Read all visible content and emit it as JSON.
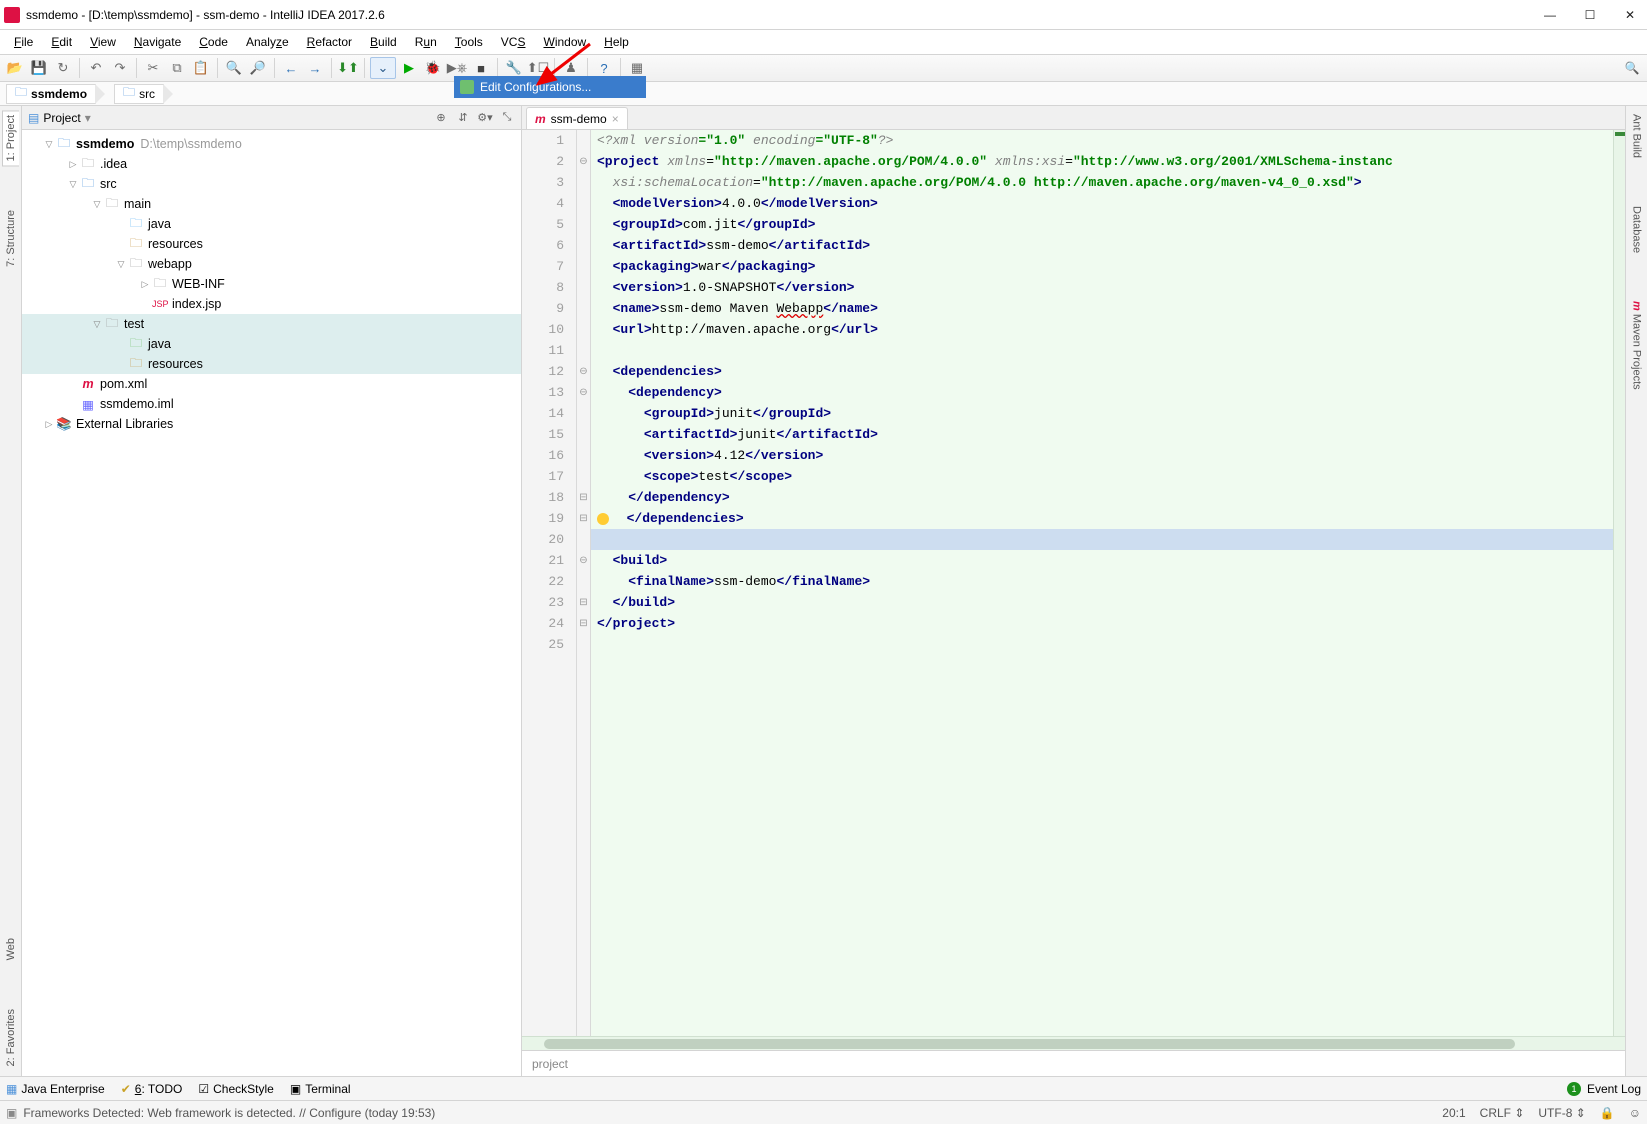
{
  "window": {
    "title": "ssmdemo - [D:\\temp\\ssmdemo] - ssm-demo - IntelliJ IDEA 2017.2.6"
  },
  "menu": {
    "items": [
      "File",
      "Edit",
      "View",
      "Navigate",
      "Code",
      "Analyze",
      "Refactor",
      "Build",
      "Run",
      "Tools",
      "VCS",
      "Window",
      "Help"
    ]
  },
  "runDropdown": {
    "label": "Edit Configurations..."
  },
  "breadcrumbs": {
    "a": "ssmdemo",
    "b": "src"
  },
  "leftTabs": {
    "project": "1: Project",
    "structure": "7: Structure",
    "web": "Web",
    "favorites": "2: Favorites"
  },
  "rightTabs": {
    "ant": "Ant Build",
    "database": "Database",
    "maven": "Maven Projects"
  },
  "projectPane": {
    "title": "Project",
    "root": {
      "name": "ssmdemo",
      "path": "D:\\temp\\ssmdemo"
    },
    "idea": ".idea",
    "src": "src",
    "main": "main",
    "java": "java",
    "resources": "resources",
    "webapp": "webapp",
    "webinf": "WEB-INF",
    "indexjsp": "index.jsp",
    "test": "test",
    "pom": "pom.xml",
    "iml": "ssmdemo.iml",
    "extlib": "External Libraries"
  },
  "editor": {
    "tabName": "ssm-demo",
    "crumb": "project",
    "lines": [
      {
        "n": 1
      },
      {
        "n": 2
      },
      {
        "n": 3
      },
      {
        "n": 4
      },
      {
        "n": 5
      },
      {
        "n": 6
      },
      {
        "n": 7
      },
      {
        "n": 8
      },
      {
        "n": 9
      },
      {
        "n": 10
      },
      {
        "n": 11
      },
      {
        "n": 12
      },
      {
        "n": 13
      },
      {
        "n": 14
      },
      {
        "n": 15
      },
      {
        "n": 16
      },
      {
        "n": 17
      },
      {
        "n": 18
      },
      {
        "n": 19
      },
      {
        "n": 20
      },
      {
        "n": 21
      },
      {
        "n": 22
      },
      {
        "n": 23
      },
      {
        "n": 24
      },
      {
        "n": 25
      }
    ],
    "xml": {
      "decl_a": "<?xml version",
      "decl_b": "=\"1.0\"",
      "decl_c": " encoding",
      "decl_d": "=\"UTF-8\"",
      "decl_e": "?>",
      "proj_open": "<project ",
      "xmlns": "xmlns",
      "eq": "=",
      "url1": "\"http://maven.apache.org/POM/4.0.0\"",
      "sp": " ",
      "xmlnsxsi": "xmlns:xsi",
      "url2": "\"http://www.w3.org/2001/XMLSchema-instanc",
      "schemaLoc": "xsi:schemaLocation",
      "url3": "\"http://maven.apache.org/POM/4.0.0 http://maven.apache.org/maven-v4_0_0.xsd\"",
      ">": ">",
      "mv_o": "<modelVersion>",
      "mv": "4.0.0",
      "mv_c": "</modelVersion>",
      "gid_o": "<groupId>",
      "gid": "com.jit",
      "gid_c": "</groupId>",
      "aid_o": "<artifactId>",
      "aid": "ssm-demo",
      "aid_c": "</artifactId>",
      "pkg_o": "<packaging>",
      "pkg": "war",
      "pkg_c": "</packaging>",
      "ver_o": "<version>",
      "ver": "1.0-SNAPSHOT",
      "ver_c": "</version>",
      "name_o": "<name>",
      "name_a": "ssm-demo Maven ",
      "name_b": "Webapp",
      "name_c": "</name>",
      "url_o": "<url>",
      "url_v": "http://maven.apache.org",
      "url_c": "</url>",
      "deps_o": "<dependencies>",
      "dep_o": "<dependency>",
      "dgid_o": "<groupId>",
      "dgid": "junit",
      "dgid_c": "</groupId>",
      "daid_o": "<artifactId>",
      "daid": "junit",
      "daid_c": "</artifactId>",
      "dver_o": "<version>",
      "dver": "4.12",
      "dver_c": "</version>",
      "scope_o": "<scope>",
      "scope": "test",
      "scope_c": "</scope>",
      "dep_c": "</dependency>",
      "deps_c": "</dependencies>",
      "build_o": "<build>",
      "fn_o": "<finalName>",
      "fn": "ssm-demo",
      "fn_c": "</finalName>",
      "build_c": "</build>",
      "proj_c": "</project>"
    }
  },
  "bottomTabs": {
    "je": "Java Enterprise",
    "todo": "6: TODO",
    "check": "CheckStyle",
    "term": "Terminal",
    "eventlog": "Event Log"
  },
  "status": {
    "msg": "Frameworks Detected: Web framework is detected. // Configure (today 19:53)",
    "pos": "20:1",
    "crlf": "CRLF",
    "enc": "UTF-8",
    "eventbadge": "1"
  }
}
